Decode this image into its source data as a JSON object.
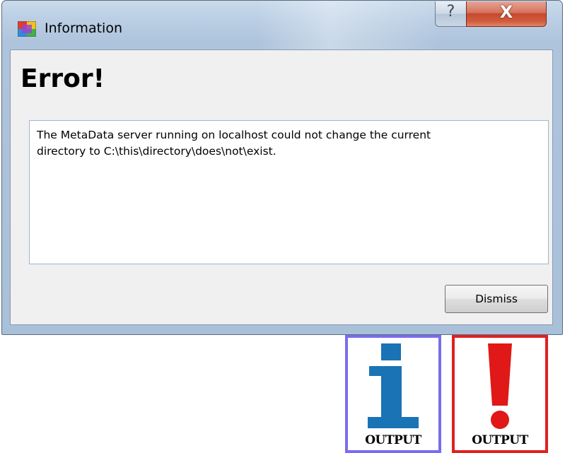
{
  "window": {
    "title": "Information",
    "help_glyph": "?",
    "close_glyph": "X"
  },
  "dialog": {
    "heading": "Error!",
    "message": "The MetaData server running on localhost could not change the current\ndirectory to C:\\this\\directory\\does\\not\\exist.",
    "dismiss_label": "Dismiss"
  },
  "output_icons": [
    {
      "label": "OUTPUT",
      "icon": "info-i-icon",
      "border_color": "#7a6cf0",
      "glyph_color": "#1a73b5"
    },
    {
      "label": "OUTPUT",
      "icon": "exclamation-icon",
      "border_color": "#e02020",
      "glyph_color": "#e01818"
    }
  ]
}
